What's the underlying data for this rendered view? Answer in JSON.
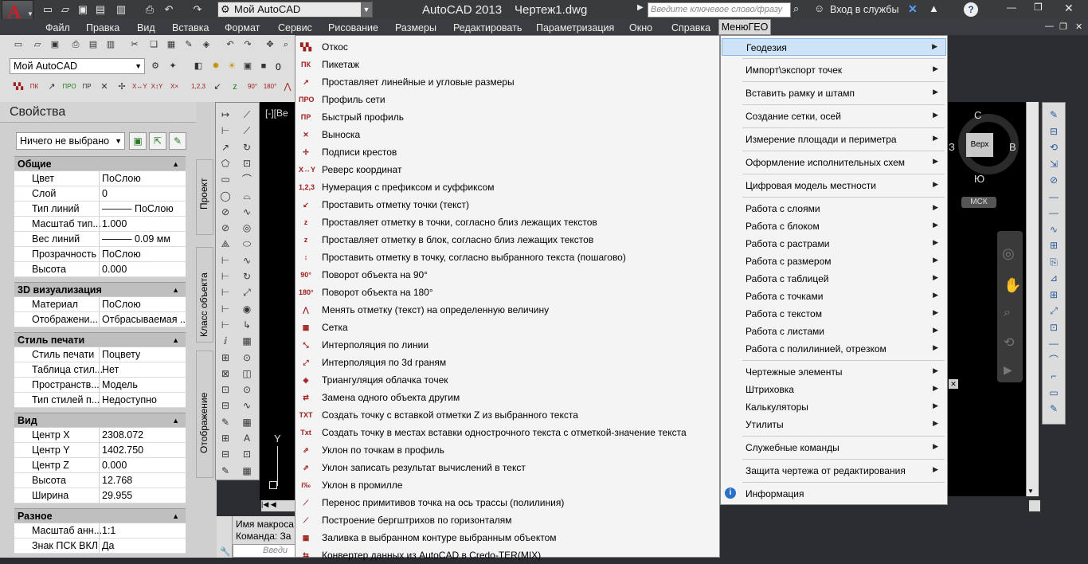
{
  "titlebar": {
    "app": "AutoCAD 2013",
    "drawing": "Чертеж1.dwg",
    "workspace": "Мой AutoCAD",
    "search_placeholder": "Введите ключевое слово/фразу",
    "signin": "Вход в службы",
    "help": "?"
  },
  "menubar": {
    "items": [
      "Файл",
      "Правка",
      "Вид",
      "Вставка",
      "Формат",
      "Сервис",
      "Рисование",
      "Размеры",
      "Редактировать",
      "Параметризация",
      "Окно",
      "Справка"
    ],
    "active": "МенюГЕО"
  },
  "toolbar": {
    "workspace_combo": "Мой AutoCAD",
    "layer_value": "0"
  },
  "properties": {
    "title": "Свойства",
    "selection": "Ничего не выбрано",
    "tabs": [
      "Проект",
      "Класс объекта",
      "Отображение"
    ],
    "sections": [
      {
        "name": "Общие",
        "rows": [
          [
            "Цвет",
            "ПоСлою"
          ],
          [
            "Слой",
            "0"
          ],
          [
            "Тип линий",
            "——— ПоСлою"
          ],
          [
            "Масштаб тип...",
            "1.000"
          ],
          [
            "Вес линий",
            "——— 0.09 мм"
          ],
          [
            "Прозрачность",
            "ПоСлою"
          ],
          [
            "Высота",
            "0.000"
          ]
        ]
      },
      {
        "name": "3D визуализация",
        "rows": [
          [
            "Материал",
            "ПоСлою"
          ],
          [
            "Отображени...",
            "Отбрасываемая ..."
          ]
        ]
      },
      {
        "name": "Стиль печати",
        "rows": [
          [
            "Стиль печати",
            "Поцвету"
          ],
          [
            "Таблица стил...",
            "Нет"
          ],
          [
            "Пространств...",
            "Модель"
          ],
          [
            "Тип стилей п...",
            "Недоступно"
          ]
        ]
      },
      {
        "name": "Вид",
        "rows": [
          [
            "Центр X",
            "2308.072"
          ],
          [
            "Центр Y",
            "1402.750"
          ],
          [
            "Центр Z",
            "0.000"
          ],
          [
            "Высота",
            "12.768"
          ],
          [
            "Ширина",
            "29.955"
          ]
        ]
      },
      {
        "name": "Разное",
        "rows": [
          [
            "Масштаб анн...",
            "1:1"
          ],
          [
            "Знак ПСК ВКЛ",
            "Да"
          ]
        ]
      }
    ]
  },
  "command": {
    "line1": "Имя макроса",
    "line2": "Команда: За",
    "input_placeholder": "Введи"
  },
  "viewport": {
    "label": "[-][Ве",
    "ucs_y": "Y",
    "cube_top": "Верх",
    "cube_n": "С",
    "cube_s": "Ю",
    "cube_e": "В",
    "cube_w": "З",
    "wcs": "МСК"
  },
  "geo_menu": {
    "items": [
      {
        "icon": "otkos",
        "label": "Откос"
      },
      {
        "icon": "piket",
        "label": "Пикетаж"
      },
      {
        "icon": "dim",
        "label": "Проставляет линейные и угловые размеры"
      },
      {
        "icon": "profile",
        "label": "Профиль сети"
      },
      {
        "icon": "fastprof",
        "label": "Быстрый профиль"
      },
      {
        "icon": "leader",
        "label": "Выноска"
      },
      {
        "icon": "cross",
        "label": "Подписи крестов"
      },
      {
        "icon": "reverse",
        "label": "Реверс координат"
      },
      {
        "icon": "numbering",
        "label": "Нумерация с префиксом и суффиксом"
      },
      {
        "icon": "mark",
        "label": "Проставить отметку точки (текст)"
      },
      {
        "icon": "markpt",
        "label": "Проставляет отметку в точки, согласно близ лежащих текстов"
      },
      {
        "icon": "markblk",
        "label": "Проставляет отметку в блок, согласно близ лежащих текстов"
      },
      {
        "icon": "markstep",
        "label": "Проставить отметку в точку, согласно выбранного текста (пошагово)"
      },
      {
        "icon": "rot90",
        "label": "Поворот объекта на 90°"
      },
      {
        "icon": "rot180",
        "label": "Поворот объекта на 180°"
      },
      {
        "icon": "change",
        "label": "Менять отметку (текст) на определенную величину"
      },
      {
        "icon": "grid",
        "label": "Сетка"
      },
      {
        "icon": "interp",
        "label": "Интерполяция по линии"
      },
      {
        "icon": "interp3d",
        "label": "Интерполяция по 3d граням"
      },
      {
        "icon": "triang",
        "label": "Триангуляция облачка точек"
      },
      {
        "icon": "replace",
        "label": "Замена одного объекта другим"
      },
      {
        "icon": "txt",
        "label": "Создать точку с вставкой отметки Z из выбранного текста"
      },
      {
        "icon": "txtz",
        "label": "Создать точку в местах вставки однострочного текста с отметкой-значение текста"
      },
      {
        "icon": "slope",
        "label": "Уклон по точкам в профиль"
      },
      {
        "icon": "slopetxt",
        "label": "Уклон записать результат вычислений в текст"
      },
      {
        "icon": "permil",
        "label": "Уклон в промилле"
      },
      {
        "icon": "transfer",
        "label": "Перенос примитивов точка на ось трассы (полилиния)"
      },
      {
        "icon": "berg",
        "label": "Построение бергштрихов по горизонталям"
      },
      {
        "icon": "fill",
        "label": "Заливка в выбранном контуре выбранным объектом"
      },
      {
        "icon": "conv",
        "label": "Конвертер данных из AutoCAD в Credo-TER(MIX)"
      }
    ]
  },
  "geo_submenu": {
    "items": [
      {
        "label": "Геодезия",
        "arrow": true,
        "highlight": true
      },
      {
        "sep": true
      },
      {
        "label": "Импорт\\экспорт точек",
        "arrow": true
      },
      {
        "sep": true
      },
      {
        "label": "Вставить рамку и штамп",
        "arrow": true
      },
      {
        "sep": true
      },
      {
        "label": "Создание сетки, осей",
        "arrow": true
      },
      {
        "sep": true
      },
      {
        "label": "Измерение площади и периметра",
        "arrow": true
      },
      {
        "sep": true
      },
      {
        "label": "Оформление исполнительных схем",
        "arrow": true
      },
      {
        "sep": true
      },
      {
        "label": "Цифровая модель местности",
        "arrow": true
      },
      {
        "sep": true
      },
      {
        "label": "Работа с слоями",
        "arrow": true
      },
      {
        "label": "Работа с блоком",
        "arrow": true
      },
      {
        "label": "Работа с растрами",
        "arrow": true
      },
      {
        "label": "Работа с размером",
        "arrow": true
      },
      {
        "label": "Работа с таблицей",
        "arrow": true
      },
      {
        "label": "Работа с точками",
        "arrow": true
      },
      {
        "label": "Работа с текстом",
        "arrow": true
      },
      {
        "label": "Работа с листами",
        "arrow": true
      },
      {
        "label": "Работа с полилинией, отрезком",
        "arrow": true
      },
      {
        "sep": true
      },
      {
        "label": "Чертежные элементы",
        "arrow": true
      },
      {
        "label": "Штриховка",
        "arrow": true
      },
      {
        "label": "Калькуляторы",
        "arrow": true
      },
      {
        "label": "Утилиты",
        "arrow": true
      },
      {
        "sep": true
      },
      {
        "label": "Служебные команды",
        "arrow": true
      },
      {
        "sep": true
      },
      {
        "label": "Защита чертежа от редактирования",
        "arrow": true
      },
      {
        "sep": true
      },
      {
        "label": "Информация",
        "arrow": false,
        "icon": "info"
      }
    ]
  }
}
